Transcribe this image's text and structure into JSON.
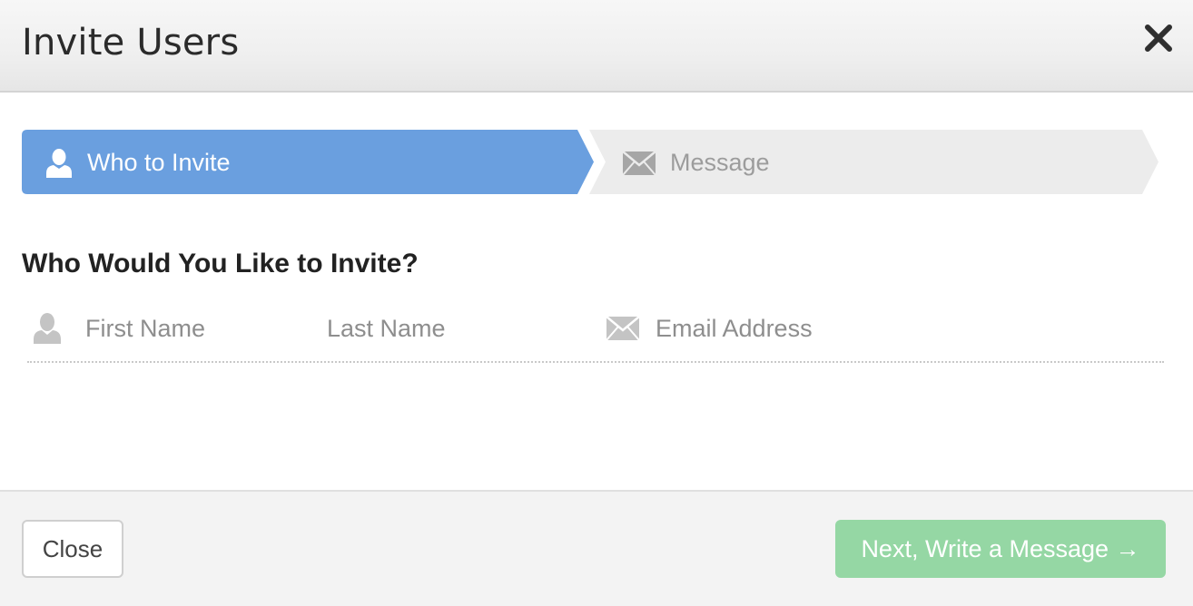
{
  "dialog": {
    "title": "Invite Users",
    "close_icon": "close-x-icon"
  },
  "steps": [
    {
      "label": "Who to Invite",
      "icon": "user-icon",
      "active": true,
      "color": "#6a9fdf"
    },
    {
      "label": "Message",
      "icon": "envelope-icon",
      "active": false,
      "color": "#ececec"
    }
  ],
  "section": {
    "title": "Who Would You Like to Invite?"
  },
  "fields": {
    "first_name_placeholder": "First Name",
    "last_name_placeholder": "Last Name",
    "email_placeholder": "Email Address",
    "first_name_value": "",
    "last_name_value": "",
    "email_value": ""
  },
  "footer": {
    "close_label": "Close",
    "next_label": "Next, Write a Message →",
    "next_color": "#95d7a4"
  }
}
